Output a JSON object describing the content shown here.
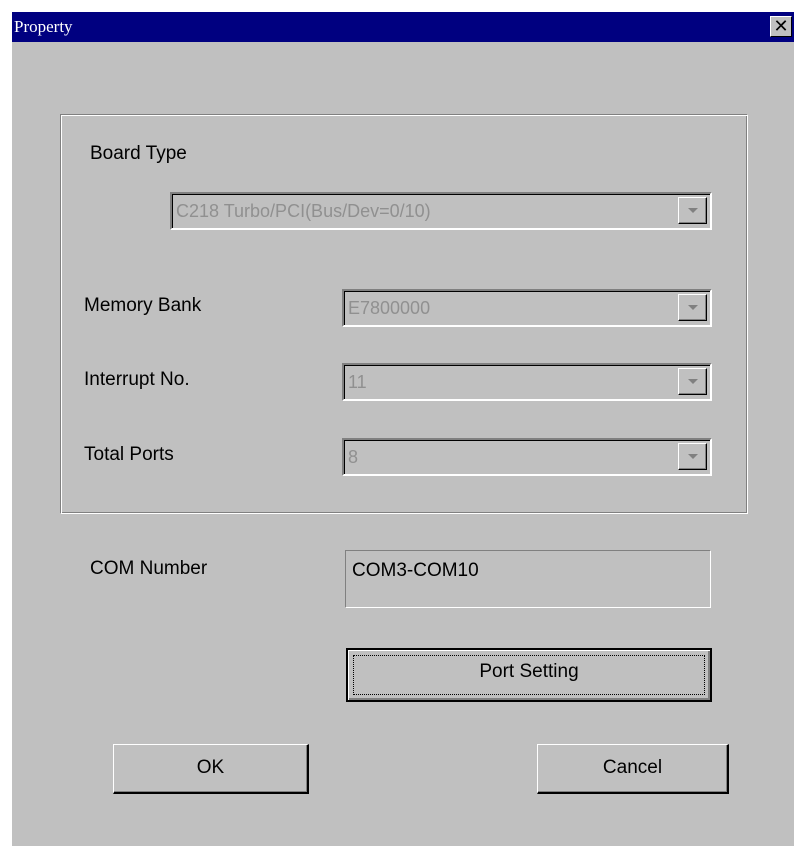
{
  "window": {
    "title": "Property",
    "close_glyph": "✕"
  },
  "form": {
    "board_type": {
      "label": "Board Type",
      "value": "C218 Turbo/PCI(Bus/Dev=0/10)",
      "disabled": true
    },
    "memory_bank": {
      "label": "Memory Bank",
      "value": "E7800000",
      "disabled": true
    },
    "interrupt_no": {
      "label": "Interrupt No.",
      "value": "11",
      "disabled": true
    },
    "total_ports": {
      "label": "Total Ports",
      "value": "8",
      "disabled": true
    },
    "com_number": {
      "label": "COM Number",
      "value": "COM3-COM10"
    }
  },
  "buttons": {
    "port_setting": "Port Setting",
    "ok": "OK",
    "cancel": "Cancel"
  },
  "icons": {
    "close": "close-icon",
    "dropdown": "dropdown-arrow-icon"
  },
  "colors": {
    "titlebar": "#000080",
    "face": "#c0c0c0",
    "disabled_text": "#909090"
  }
}
